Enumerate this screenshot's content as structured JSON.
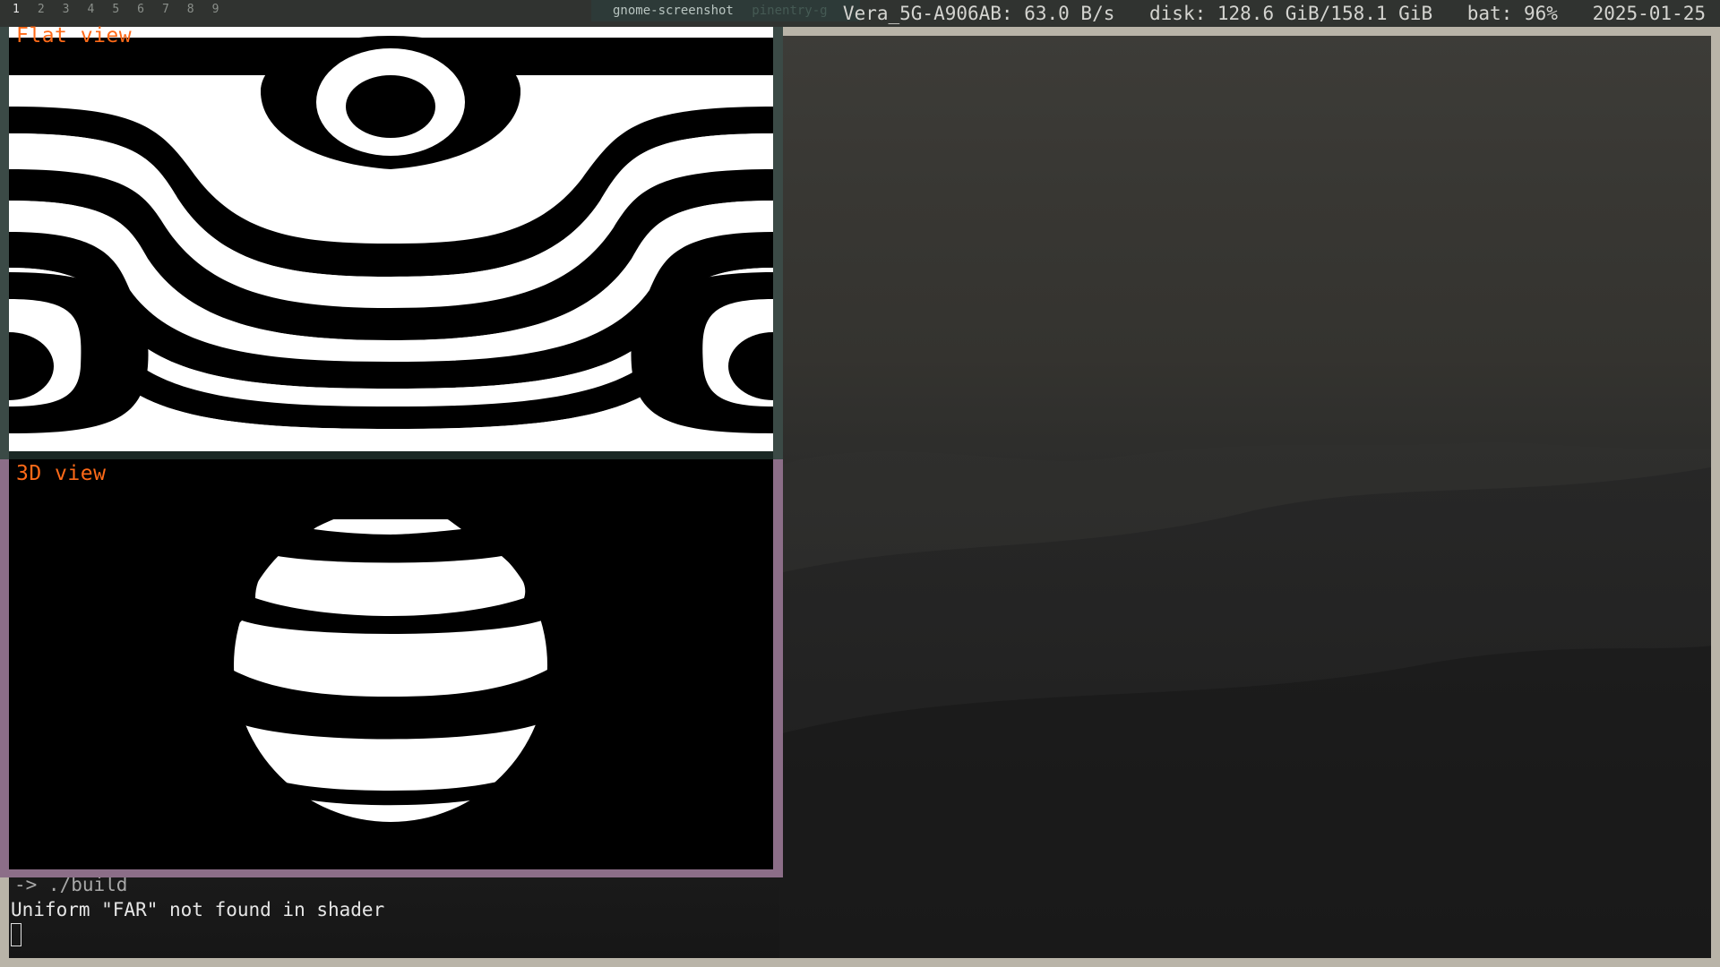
{
  "topbar": {
    "workspaces": [
      "1",
      "2",
      "3",
      "4",
      "5",
      "6",
      "7",
      "8",
      "9"
    ],
    "active_window_title": "gnome-screenshot",
    "next_window_title": "pinentry-g",
    "network": "Vera_5G-A906AB: 63.0 B/s",
    "disk": "disk: 128.6 GiB/158.1 GiB",
    "battery": "bat: 96%",
    "date": "2025-01-25"
  },
  "app": {
    "flat_view_label": "Flat view",
    "view3d_label": "3D view"
  },
  "terminal": {
    "prompt": " -> ./build",
    "output": "Uniform \"FAR\" not found in shader"
  },
  "colors": {
    "label_orange": "#ff6a18",
    "focus_border": "#b9b4a8",
    "app_border": "#8c6e88"
  }
}
